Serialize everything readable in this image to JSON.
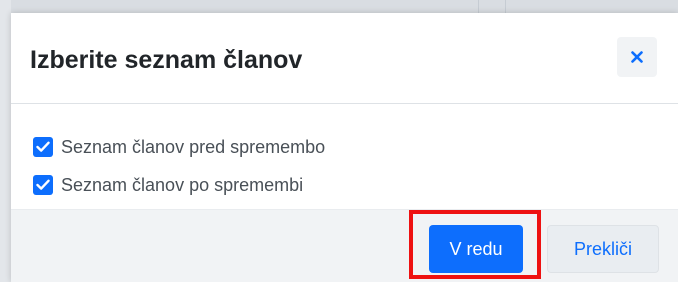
{
  "dialog": {
    "title": "Izberite seznam članov",
    "close_icon": "close-icon"
  },
  "options": [
    {
      "label": "Seznam članov pred spremembo",
      "checked": true
    },
    {
      "label": "Seznam članov po spremembi",
      "checked": true
    }
  ],
  "footer": {
    "ok_label": "V redu",
    "cancel_label": "Prekliči"
  },
  "colors": {
    "primary": "#0d6efd",
    "highlight": "#ee1111",
    "footer_bg": "#f1f3f5"
  }
}
